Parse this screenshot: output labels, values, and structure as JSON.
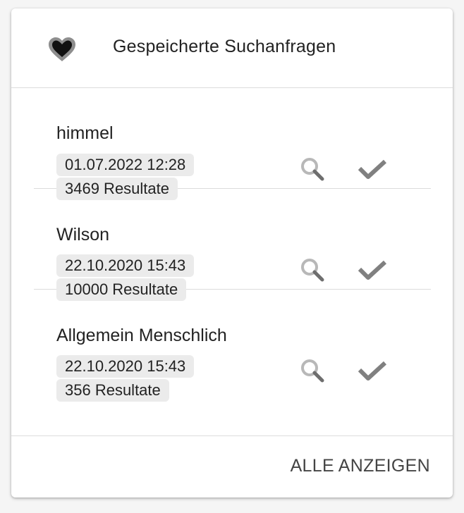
{
  "header": {
    "title": "Gespeicherte Suchanfragen",
    "icon": "heart-icon"
  },
  "saved_searches": [
    {
      "name": "himmel",
      "date": "01.07.2022 12:28",
      "results": "3469 Resultate"
    },
    {
      "name": "Wilson",
      "date": "22.10.2020 15:43",
      "results": "10000 Resultate"
    },
    {
      "name": "Allgemein Menschlich",
      "date": "22.10.2020 15:43",
      "results": "356 Resultate"
    }
  ],
  "item_actions": {
    "search_icon": "search-icon",
    "check_icon": "check-icon"
  },
  "footer": {
    "show_all_label": "ALLE ANZEIGEN"
  },
  "colors": {
    "background": "#f5f5f5",
    "card": "#ffffff",
    "chip": "#ebebeb",
    "divider": "#dcdcdc",
    "icon_gray": "#9e9e9e",
    "text": "#222222"
  }
}
